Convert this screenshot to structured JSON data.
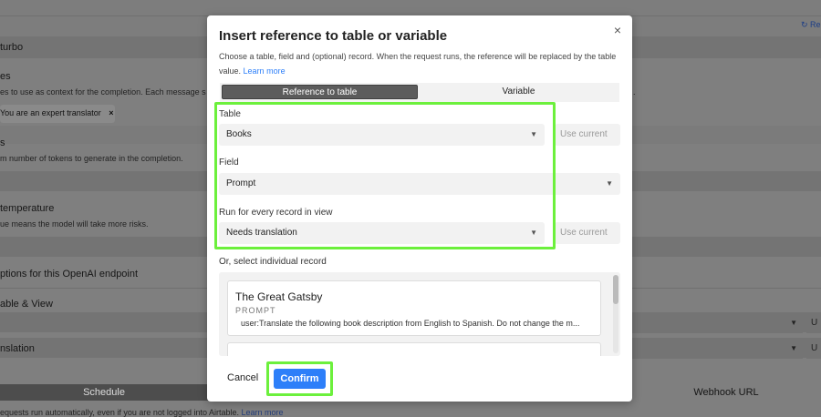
{
  "background": {
    "refresh_label": "Re",
    "model_text": "turbo",
    "messages_title": "es",
    "messages_desc": "es to use as context for the completion. Each message s",
    "chip_text": "You are an expert translator",
    "chip_remove": "×",
    "tokens_title": "s",
    "tokens_desc": "m number of tokens to generate in the completion.",
    "temperature_title": "temperature",
    "temperature_desc": "ue means the model will take more risks.",
    "options_title": "ptions for this OpenAI endpoint",
    "table_view_label": "able & View",
    "translation_label": "nslation",
    "schedule_label": "Schedule",
    "webhook_label": "Webhook URL",
    "footer_text": "equests run automatically, even if you are not logged into Airtable.",
    "footer_link": "Learn more",
    "right_sel_1": "U",
    "right_sel_2": "U",
    "trailing_dot": "."
  },
  "modal": {
    "title": "Insert reference to table or variable",
    "close_icon": "×",
    "description": "Choose a table, field and (optional) record. When the request runs, the reference will be replaced by the table value.",
    "learn_more": "Learn more",
    "tabs": [
      {
        "label": "Reference to table",
        "active": true
      },
      {
        "label": "Variable",
        "active": false
      }
    ],
    "table_label": "Table",
    "table_value": "Books",
    "use_current_1": "Use current",
    "field_label": "Field",
    "field_value": "Prompt",
    "run_label": "Run for every record in view",
    "run_value": "Needs translation",
    "use_current_2": "Use current",
    "records_label": "Or, select individual record",
    "record": {
      "title": "The Great Gatsby",
      "field": "PROMPT",
      "value": "user:Translate the following book description from English to Spanish. Do not change the m..."
    },
    "cancel_label": "Cancel",
    "confirm_label": "Confirm"
  },
  "colors": {
    "accent": "#2d7ff9",
    "highlight": "#6cf03c"
  }
}
